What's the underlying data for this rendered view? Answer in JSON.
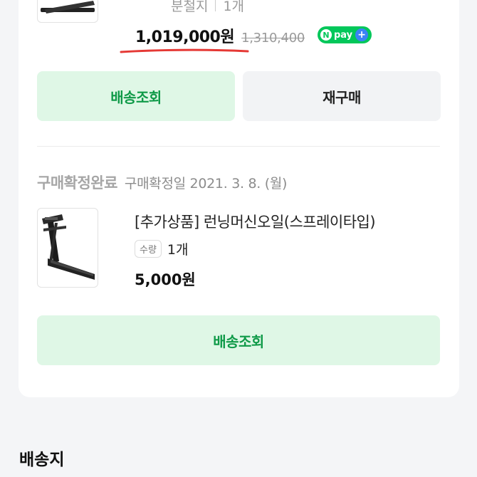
{
  "order_item_1": {
    "option_label": "분철지",
    "quantity": "1개",
    "price": "1,019,000원",
    "original_price": "1,310,400",
    "npay_label": "pay",
    "npay_n": "N"
  },
  "buttons_1": {
    "track_label": "배송조회",
    "reorder_label": "재구매"
  },
  "order_item_2": {
    "status": "구매확정완료",
    "confirm_date": "구매확정일 2021. 3. 8. (월)",
    "name": "[추가상품] 런닝머신오일(스프레이타입)",
    "qty_badge": "수량",
    "quantity": "1개",
    "price": "5,000원"
  },
  "buttons_2": {
    "track_label": "배송조회"
  },
  "shipping_section": {
    "title": "배송지"
  },
  "colors": {
    "accent_green": "#0f9a48",
    "button_green_bg": "#dff7e6",
    "npay_green": "#03c75a",
    "underline_red": "#e53935"
  },
  "icons": [
    "treadmill-product-image",
    "npay-logo"
  ]
}
